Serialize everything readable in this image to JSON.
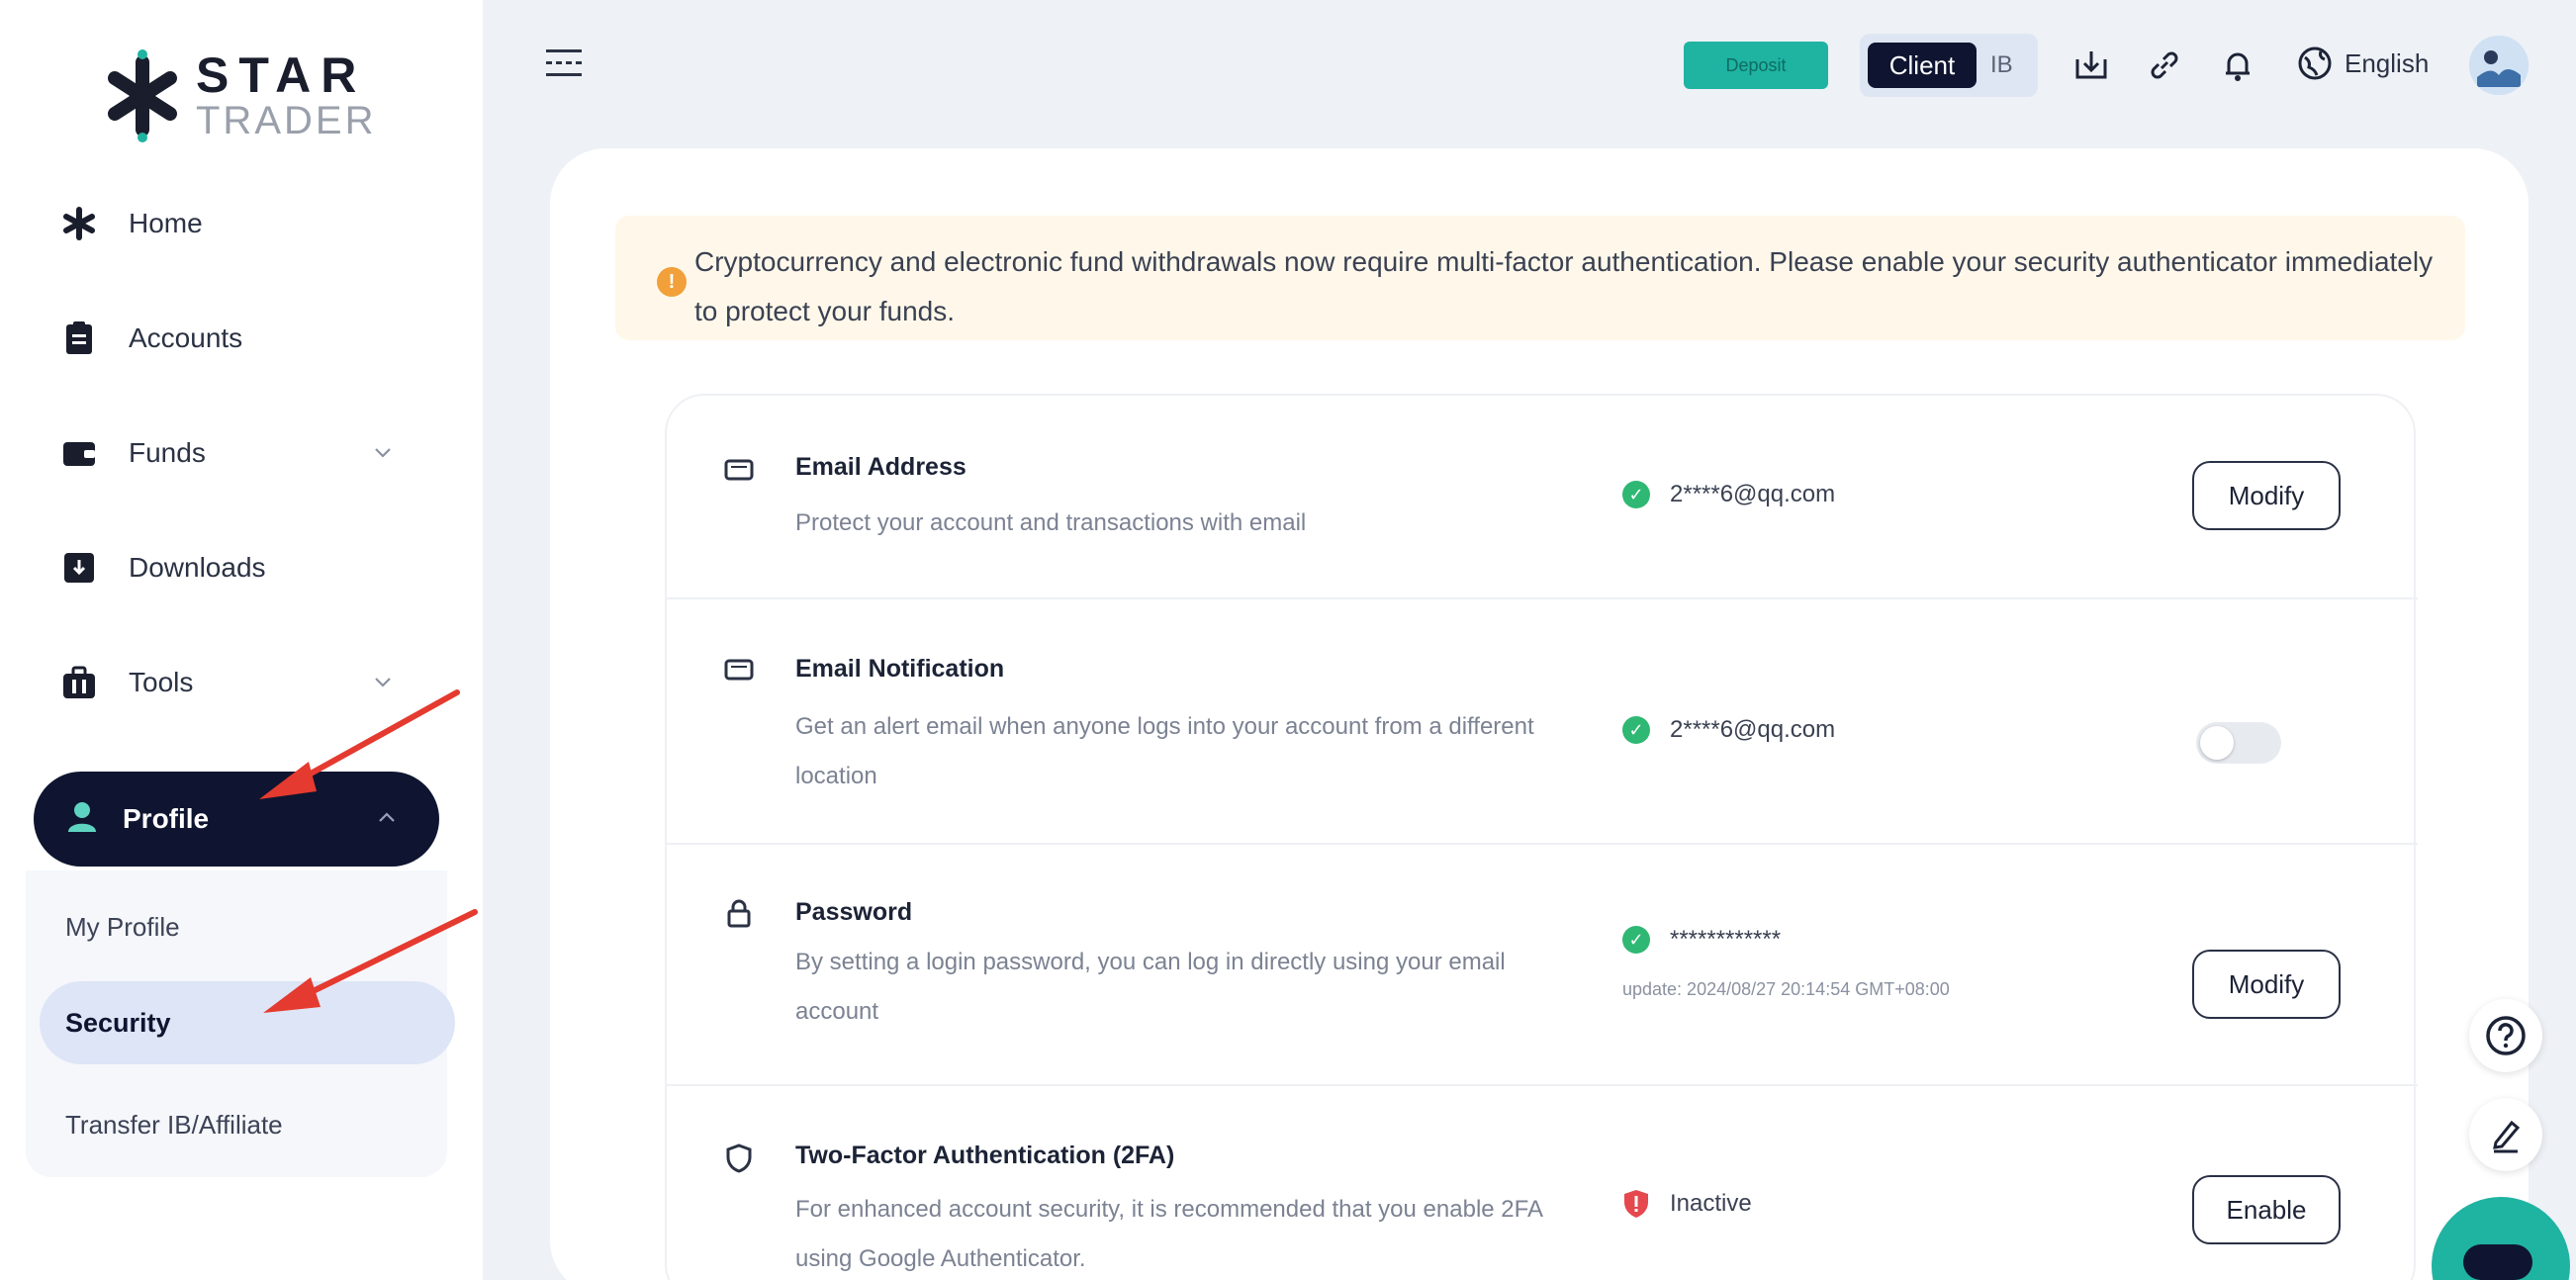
{
  "brand": {
    "name_top": "STAR",
    "name_bottom": "TRADER"
  },
  "sidebar": {
    "items": [
      {
        "label": "Home",
        "icon": "star-icon"
      },
      {
        "label": "Accounts",
        "icon": "clipboard-icon"
      },
      {
        "label": "Funds",
        "icon": "wallet-icon"
      },
      {
        "label": "Downloads",
        "icon": "download-box-icon"
      },
      {
        "label": "Tools",
        "icon": "toolbox-icon"
      }
    ],
    "profile": {
      "label": "Profile",
      "icon": "user-icon"
    },
    "profile_sub": [
      "My Profile",
      "Security",
      "Transfer IB/Affiliate"
    ]
  },
  "header": {
    "deposit_label": "Deposit",
    "role_client": "Client",
    "role_ib": "IB",
    "language": "English"
  },
  "notice": {
    "text": "Cryptocurrency and electronic fund withdrawals now require multi-factor authentication. Please enable your security authenticator immediately to protect your funds."
  },
  "security": {
    "email": {
      "title": "Email Address",
      "desc": "Protect your account and transactions with email",
      "status": "2****6@qq.com",
      "action": "Modify"
    },
    "notification": {
      "title": "Email Notification",
      "desc": "Get an alert email when anyone logs into your account from a different location",
      "status": "2****6@qq.com",
      "enabled": false
    },
    "password": {
      "title": "Password",
      "desc": "By setting a login password, you can log in directly using your email account",
      "status": "************",
      "update": "update: 2024/08/27 20:14:54 GMT+08:00",
      "action": "Modify"
    },
    "twofa": {
      "title": "Two-Factor Authentication (2FA)",
      "desc": "For enhanced account security, it is recommended that you enable 2FA using Google Authenticator.",
      "status": "Inactive",
      "action": "Enable"
    }
  },
  "colors": {
    "navy": "#0f1530",
    "teal": "#1fb3a2",
    "notice_bg": "#fff8ea",
    "success": "#2fb873",
    "danger": "#e5484d",
    "arrow": "#e53a2f"
  }
}
